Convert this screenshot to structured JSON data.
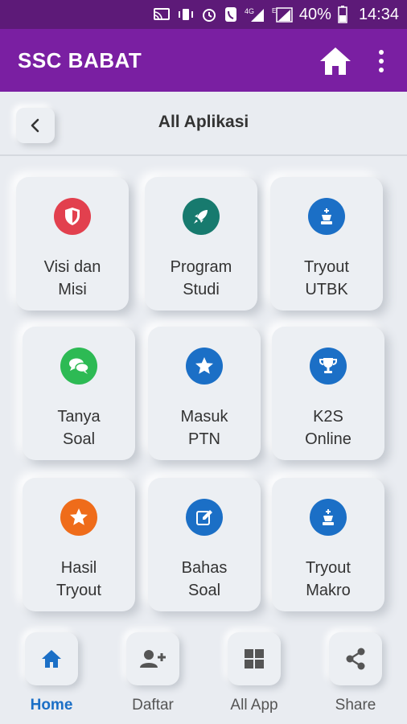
{
  "status_bar": {
    "battery": "40%",
    "time": "14:34",
    "network": "4G"
  },
  "app_bar": {
    "title": "SSC BABAT",
    "color": "#7a1fa2"
  },
  "header": {
    "title": "All Aplikasi"
  },
  "apps": [
    {
      "label": "Visi dan\nMisi",
      "icon": "shield-icon",
      "color": "#e2404e"
    },
    {
      "label": "Program\nStudi",
      "icon": "rocket-icon",
      "color": "#177a6e"
    },
    {
      "label": "Tryout\nUTBK",
      "icon": "chess-king-icon",
      "color": "#1b6fc6"
    },
    {
      "label": "Tanya\nSoal",
      "icon": "chat-icon",
      "color": "#2dba54"
    },
    {
      "label": "Masuk\nPTN",
      "icon": "star-icon",
      "color": "#1b6fc6"
    },
    {
      "label": "K2S\nOnline",
      "icon": "trophy-icon",
      "color": "#1b6fc6"
    },
    {
      "label": "Hasil\nTryout",
      "icon": "star-icon",
      "color": "#ef6c1a"
    },
    {
      "label": "Bahas\nSoal",
      "icon": "edit-icon",
      "color": "#1b6fc6"
    },
    {
      "label": "Tryout\nMakro",
      "icon": "chess-king-icon",
      "color": "#1b6fc6"
    }
  ],
  "bottom_nav": [
    {
      "label": "Home",
      "icon": "home-icon",
      "active": true
    },
    {
      "label": "Daftar",
      "icon": "add-user-icon",
      "active": false
    },
    {
      "label": "All App",
      "icon": "grid-icon",
      "active": false
    },
    {
      "label": "Share",
      "icon": "share-icon",
      "active": false
    }
  ],
  "accent_color": "#1b6fc6"
}
